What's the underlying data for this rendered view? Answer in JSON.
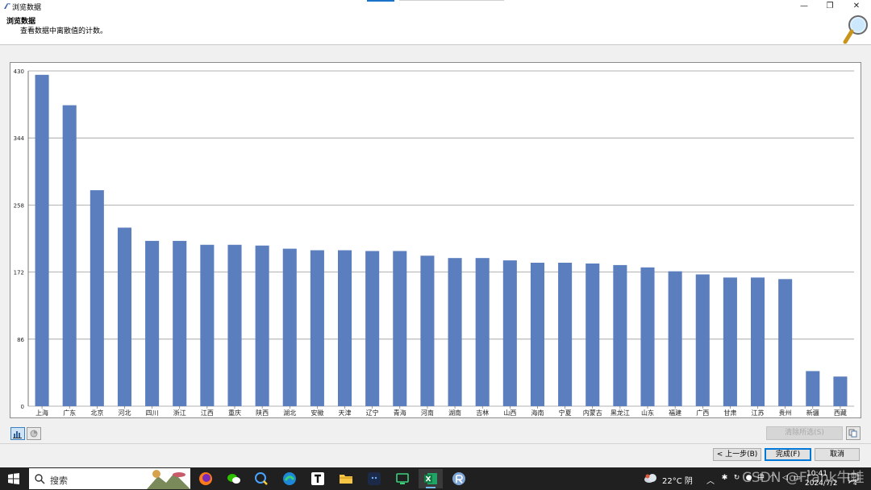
{
  "window": {
    "title": "浏览数据",
    "controls": {
      "minimize": "—",
      "maximize": "❐",
      "close": "✕"
    }
  },
  "header": {
    "title": "浏览数据",
    "subtitle": "查看数据中离散值的计数。"
  },
  "chart_data": {
    "type": "bar",
    "categories": [
      "上海",
      "广东",
      "北京",
      "河北",
      "四川",
      "浙江",
      "江西",
      "重庆",
      "陕西",
      "湖北",
      "安徽",
      "天津",
      "辽宁",
      "青海",
      "河南",
      "湖南",
      "吉林",
      "山西",
      "海南",
      "宁夏",
      "内蒙古",
      "黑龙江",
      "山东",
      "福建",
      "广西",
      "甘肃",
      "江苏",
      "贵州",
      "新疆",
      "西藏"
    ],
    "values": [
      425,
      386,
      277,
      229,
      212,
      212,
      207,
      207,
      206,
      202,
      200,
      200,
      199,
      199,
      193,
      190,
      190,
      187,
      184,
      184,
      183,
      181,
      178,
      173,
      169,
      165,
      165,
      163,
      45,
      38
    ],
    "yticks": [
      "0",
      "86",
      "172",
      "258",
      "344",
      "430"
    ],
    "ylim": [
      0,
      430
    ],
    "grid": true,
    "bar_color": "#5b7fbe"
  },
  "view_toggle": {
    "bar_icon": "bar-chart-icon",
    "pie_icon": "pie-chart-icon"
  },
  "disabled_button": {
    "label": "清除所选(S)"
  },
  "buttons": {
    "prev": "< 上一步(B)",
    "finish": "完成(F)",
    "cancel": "取消"
  },
  "taskbar": {
    "search_label": "搜索",
    "weather": "22°C 阴",
    "clock_time": "10:41",
    "clock_date": "2024/7/2",
    "notifications": "4"
  },
  "watermark": "CSDN @Frank牛蛙"
}
